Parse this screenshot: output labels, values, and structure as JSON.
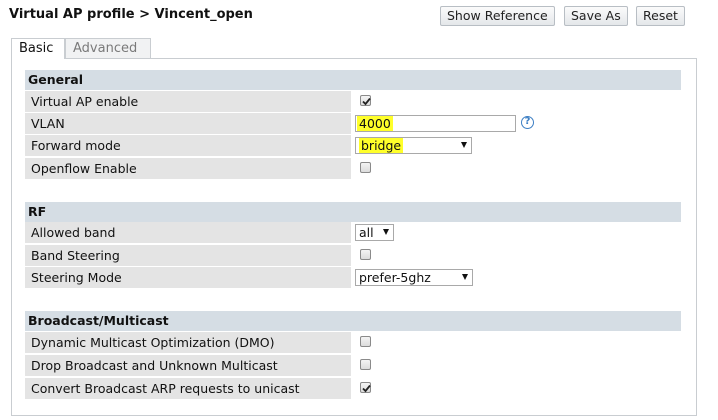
{
  "header": {
    "title": "Virtual AP profile > Vincent_open",
    "buttons": {
      "show_reference": "Show Reference",
      "save_as": "Save As",
      "reset": "Reset"
    }
  },
  "tabs": [
    {
      "label": "Basic",
      "active": true
    },
    {
      "label": "Advanced",
      "active": false
    }
  ],
  "general": {
    "heading": "General",
    "virtual_ap_enable": {
      "label": "Virtual AP enable",
      "checked": true
    },
    "vlan": {
      "label": "VLAN",
      "value": "4000",
      "help_icon": "question-icon"
    },
    "forward_mode": {
      "label": "Forward mode",
      "value": "bridge"
    },
    "openflow_enable": {
      "label": "Openflow Enable",
      "checked": false
    }
  },
  "rf": {
    "heading": "RF",
    "allowed_band": {
      "label": "Allowed band",
      "value": "all"
    },
    "band_steering": {
      "label": "Band Steering",
      "checked": false
    },
    "steering_mode": {
      "label": "Steering Mode",
      "value": "prefer-5ghz"
    }
  },
  "broadcast": {
    "heading": "Broadcast/Multicast",
    "dmo": {
      "label": "Dynamic Multicast Optimization (DMO)",
      "checked": false
    },
    "drop_broadcast": {
      "label": "Drop Broadcast and Unknown Multicast",
      "checked": false
    },
    "convert_arp": {
      "label": "Convert Broadcast ARP requests to unicast",
      "checked": true
    }
  },
  "colors": {
    "section_header": "#d5dde4",
    "row_label": "#e4e4e4",
    "highlight": "#ffff2a",
    "help_icon": "#3d7fc4"
  }
}
